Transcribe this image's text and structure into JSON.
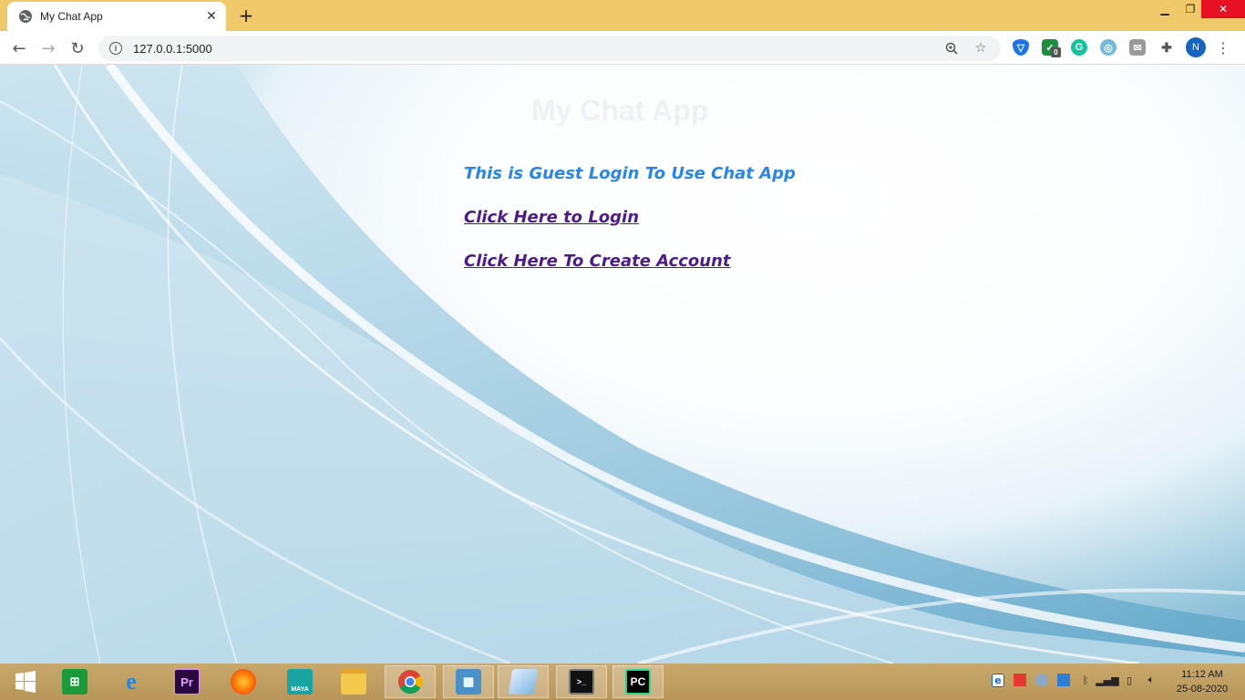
{
  "browser": {
    "tab_title": "My Chat App",
    "new_tab": "+",
    "url": "127.0.0.1:5000",
    "profile_initial": "N",
    "extension_badge": "0"
  },
  "page": {
    "title": "My Chat App",
    "guest_text": "This is Guest Login To Use Chat App",
    "login_link": "Click Here to Login",
    "create_link": "Click Here To Create Account"
  },
  "taskbar": {
    "apps": [
      "start-icon",
      "store-icon",
      "internet-explorer-icon",
      "premiere-icon",
      "firefox-icon",
      "maya-icon",
      "file-explorer-icon",
      "chrome-icon",
      "control-panel-icon",
      "notepad-icon",
      "terminal-icon",
      "pycharm-icon"
    ],
    "premiere_label": "Pr",
    "pycharm_label": "PC",
    "maya_label": "MAYA",
    "time": "11:12 AM",
    "date": "25-08-2020"
  },
  "colors": {
    "titlebar": "#f0c96a",
    "guest_text": "#2a86e6",
    "link": "#4e1c8a",
    "close_button": "#e81123"
  }
}
